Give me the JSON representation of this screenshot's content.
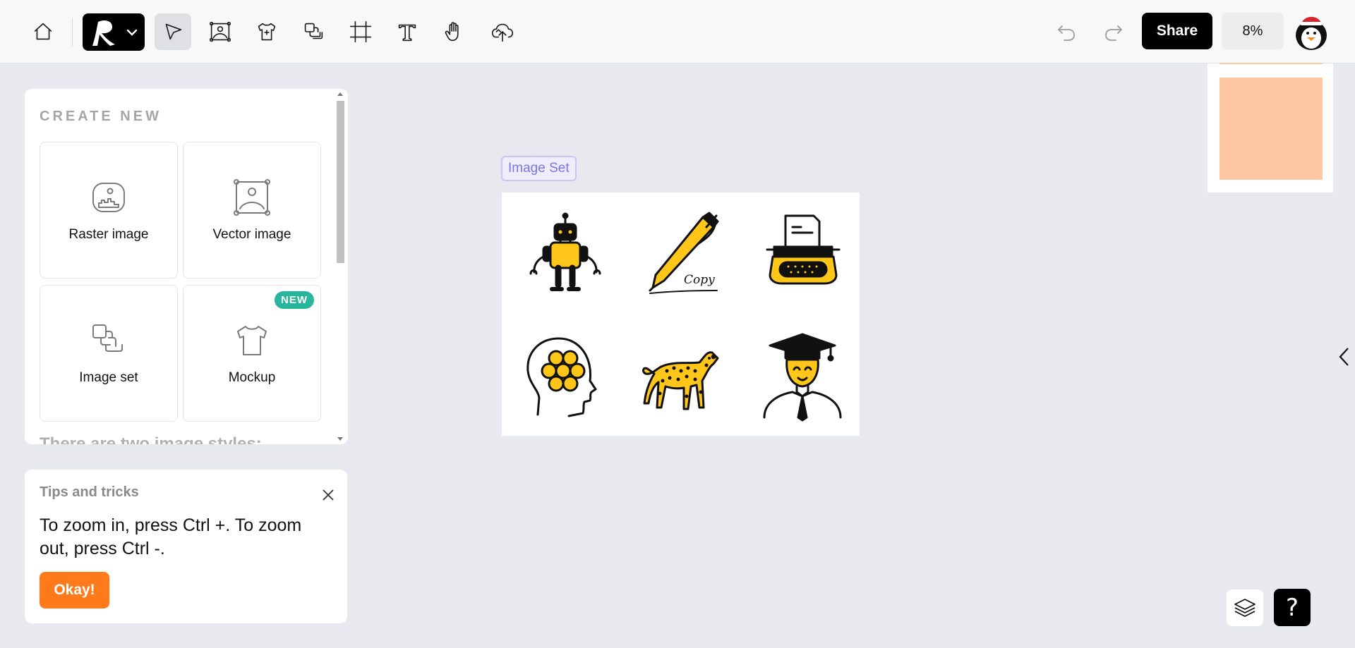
{
  "toolbar": {
    "icons": [
      "home-icon",
      "logo-icon",
      "chevron-down-icon",
      "select-arrow-icon",
      "vector-image-icon",
      "mockup-shirt-icon",
      "image-set-icon",
      "crop-frame-icon",
      "text-tool-icon",
      "hand-tool-icon",
      "upload-cloud-icon",
      "undo-icon",
      "redo-icon"
    ],
    "share_label": "Share",
    "zoom_label": "8%"
  },
  "create_panel": {
    "heading": "CREATE NEW",
    "cards": [
      {
        "label": "Raster image",
        "icon": "raster-image-icon"
      },
      {
        "label": "Vector image",
        "icon": "vector-image-icon"
      },
      {
        "label": "Image set",
        "icon": "image-set-icon"
      },
      {
        "label": "Mockup",
        "icon": "mockup-shirt-icon",
        "badge": "NEW"
      }
    ],
    "footer_text": "There are two image styles:"
  },
  "tips": {
    "title": "Tips and tricks",
    "text": "To zoom in, press Ctrl +. To zoom out, press Ctrl -.",
    "button_label": "Okay!"
  },
  "canvas": {
    "set_label": "Image Set",
    "pen_caption": "Copy",
    "images": [
      "robot",
      "pen",
      "typewriter",
      "brain-head",
      "cheetah",
      "graduate"
    ]
  },
  "colors": {
    "accent_orange": "#ff7a1a",
    "badge_teal": "#27b59b",
    "illustration_yellow": "#ffc61a",
    "peach": "#ffc8a3",
    "set_label_purple": "#7d72e6"
  },
  "help_label": "?"
}
